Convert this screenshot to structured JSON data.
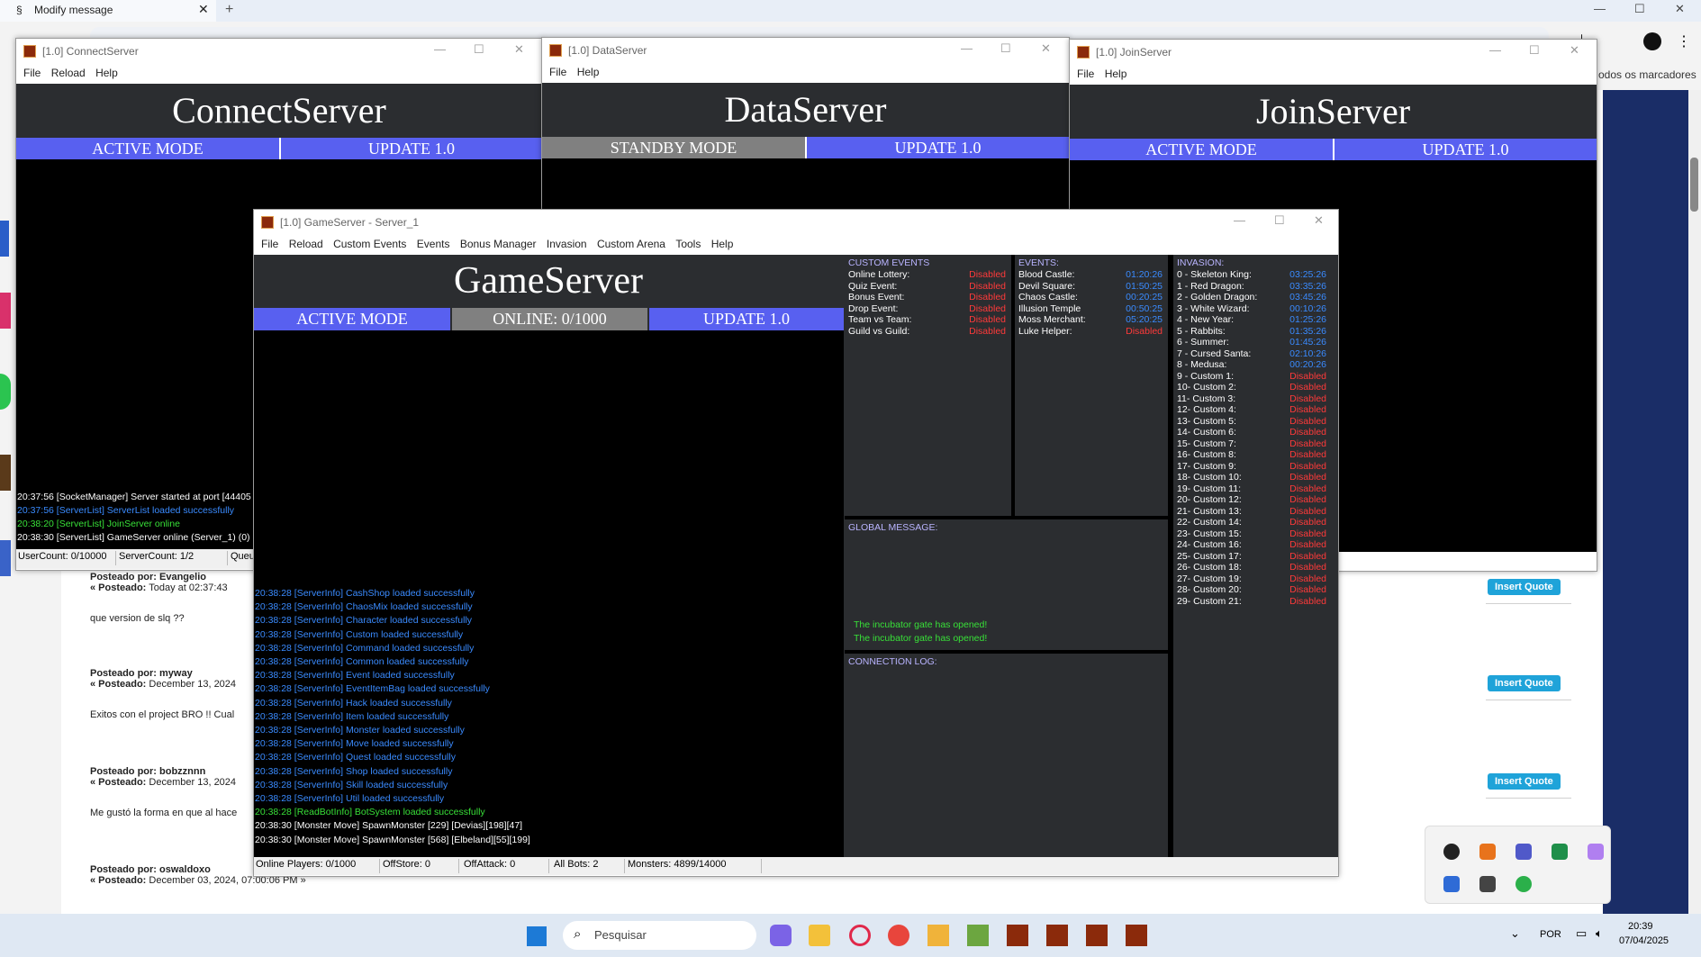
{
  "browser": {
    "tab_title": "Modify message",
    "new_tab": "+",
    "bookmarks_text": "odos os marcadores"
  },
  "forum": {
    "posts": [
      {
        "by_label": "Posteado por:",
        "author": "Evangelio",
        "date_label": "« Posteado:",
        "date": "Today at 02:37:43",
        "body": "que version de slq ??",
        "quote_button": "Insert Quote"
      },
      {
        "by_label": "Posteado por:",
        "author": "myway",
        "date_label": "« Posteado:",
        "date": "December 13, 2024",
        "body": "Exitos con el project BRO !! Cual",
        "quote_button": "Insert Quote"
      },
      {
        "by_label": "Posteado por:",
        "author": "bobzznnn",
        "date_label": "« Posteado:",
        "date": "December 13, 2024",
        "body": "Me gustó la forma en que al hace",
        "quote_button": "Insert Quote"
      },
      {
        "by_label": "Posteado por:",
        "author": "oswaldoxo",
        "date_label": "« Posteado:",
        "date": "December 03, 2024, 07:00:06 PM »",
        "body": "",
        "quote_button": ""
      }
    ]
  },
  "connect_server": {
    "window_title": "[1.0] ConnectServer",
    "menu": [
      "File",
      "Reload",
      "Help"
    ],
    "big_title": "ConnectServer",
    "mode": "ACTIVE MODE",
    "update": "UPDATE 1.0",
    "log": [
      {
        "text": "20:37:56 [SocketManager] Server started at port [44405",
        "color": "white"
      },
      {
        "text": "20:37:56 [ServerList] ServerList loaded successfully",
        "color": "blue"
      },
      {
        "text": "20:38:20 [ServerList] JoinServer online",
        "color": "green"
      },
      {
        "text": "20:38:30 [ServerList] GameServer online (Server_1) (0)",
        "color": "white"
      }
    ],
    "status": {
      "user_count": "UserCount: 0/10000",
      "server_count": "ServerCount: 1/2",
      "queue": "Queu"
    }
  },
  "data_server": {
    "window_title": "[1.0] DataServer",
    "menu": [
      "File",
      "Help"
    ],
    "big_title": "DataServer",
    "mode": "STANDBY MODE",
    "update": "UPDATE 1.0"
  },
  "join_server": {
    "window_title": "[1.0] JoinServer",
    "menu": [
      "File",
      "Help"
    ],
    "big_title": "JoinServer",
    "mode": "ACTIVE MODE",
    "update": "UPDATE 1.0"
  },
  "game_server": {
    "window_title": "[1.0] GameServer - Server_1",
    "menu": [
      "File",
      "Reload",
      "Custom Events",
      "Events",
      "Bonus Manager",
      "Invasion",
      "Custom Arena",
      "Tools",
      "Help"
    ],
    "big_title": "GameServer",
    "mode": "ACTIVE MODE",
    "online": "ONLINE: 0/1000",
    "update": "UPDATE 1.0",
    "log": [
      {
        "text": "20:38:28 [ServerInfo] CashShop loaded successfully",
        "color": "blue"
      },
      {
        "text": "20:38:28 [ServerInfo] ChaosMix loaded successfully",
        "color": "blue"
      },
      {
        "text": "20:38:28 [ServerInfo] Character loaded successfully",
        "color": "blue"
      },
      {
        "text": "20:38:28 [ServerInfo] Custom loaded successfully",
        "color": "blue"
      },
      {
        "text": "20:38:28 [ServerInfo] Command loaded successfully",
        "color": "blue"
      },
      {
        "text": "20:38:28 [ServerInfo] Common loaded successfully",
        "color": "blue"
      },
      {
        "text": "20:38:28 [ServerInfo] Event loaded successfully",
        "color": "blue"
      },
      {
        "text": "20:38:28 [ServerInfo] EventItemBag loaded successfully",
        "color": "blue"
      },
      {
        "text": "20:38:28 [ServerInfo] Hack loaded successfully",
        "color": "blue"
      },
      {
        "text": "20:38:28 [ServerInfo] Item loaded successfully",
        "color": "blue"
      },
      {
        "text": "20:38:28 [ServerInfo] Monster loaded successfully",
        "color": "blue"
      },
      {
        "text": "20:38:28 [ServerInfo] Move loaded successfully",
        "color": "blue"
      },
      {
        "text": "20:38:28 [ServerInfo] Quest loaded successfully",
        "color": "blue"
      },
      {
        "text": "20:38:28 [ServerInfo] Shop loaded successfully",
        "color": "blue"
      },
      {
        "text": "20:38:28 [ServerInfo] Skill loaded successfully",
        "color": "blue"
      },
      {
        "text": "20:38:28 [ServerInfo] Util loaded successfully",
        "color": "blue"
      },
      {
        "text": "20:38:28 [ReadBotInfo] BotSystem loaded successfully",
        "color": "green"
      },
      {
        "text": "20:38:30 [Monster Move] SpawnMonster [229] [Devias][198][47]",
        "color": "white"
      },
      {
        "text": "20:38:30 [Monster Move] SpawnMonster [568] [Elbeland][55][199]",
        "color": "white"
      }
    ],
    "custom_events": {
      "header": "CUSTOM EVENTS",
      "items": [
        {
          "name": "Online Lottery:",
          "value": "Disabled"
        },
        {
          "name": "Quiz Event:",
          "value": "Disabled"
        },
        {
          "name": "Bonus Event:",
          "value": "Disabled"
        },
        {
          "name": "Drop Event:",
          "value": "Disabled"
        },
        {
          "name": "Team vs Team:",
          "value": "Disabled"
        },
        {
          "name": "Guild vs Guild:",
          "value": "Disabled"
        }
      ]
    },
    "events": {
      "header": "EVENTS:",
      "items": [
        {
          "name": "Blood Castle:",
          "value": "01:20:26"
        },
        {
          "name": "Devil Square:",
          "value": "01:50:25"
        },
        {
          "name": "Chaos Castle:",
          "value": "00:20:25"
        },
        {
          "name": "Illusion Temple",
          "value": "00:50:25"
        },
        {
          "name": "Moss Merchant:",
          "value": "05:20:25"
        },
        {
          "name": "Luke Helper:",
          "value": "Disabled"
        }
      ]
    },
    "global_message": {
      "header": "GLOBAL MESSAGE:",
      "lines": [
        "The incubator gate has opened!",
        "The incubator gate has opened!"
      ]
    },
    "connection_log": {
      "header": "CONNECTION LOG:"
    },
    "invasion": {
      "header": "INVASION:",
      "items": [
        {
          "name": "0 - Skeleton King:",
          "value": "03:25:26"
        },
        {
          "name": "1 - Red Dragon:",
          "value": "03:35:26"
        },
        {
          "name": "2 - Golden Dragon:",
          "value": "03:45:26"
        },
        {
          "name": "3 - White Wizard:",
          "value": "00:10:26"
        },
        {
          "name": "4 - New Year:",
          "value": "01:25:26"
        },
        {
          "name": "5 - Rabbits:",
          "value": "01:35:26"
        },
        {
          "name": "6 - Summer:",
          "value": "01:45:26"
        },
        {
          "name": "7 - Cursed Santa:",
          "value": "02:10:26"
        },
        {
          "name": "8 - Medusa:",
          "value": "00:20:26"
        },
        {
          "name": "9 - Custom 1:",
          "value": "Disabled"
        },
        {
          "name": "10- Custom 2:",
          "value": "Disabled"
        },
        {
          "name": "11- Custom 3:",
          "value": "Disabled"
        },
        {
          "name": "12- Custom 4:",
          "value": "Disabled"
        },
        {
          "name": "13- Custom 5:",
          "value": "Disabled"
        },
        {
          "name": "14- Custom 6:",
          "value": "Disabled"
        },
        {
          "name": "15- Custom 7:",
          "value": "Disabled"
        },
        {
          "name": "16- Custom 8:",
          "value": "Disabled"
        },
        {
          "name": "17- Custom 9:",
          "value": "Disabled"
        },
        {
          "name": "18- Custom 10:",
          "value": "Disabled"
        },
        {
          "name": "19- Custom 11:",
          "value": "Disabled"
        },
        {
          "name": "20- Custom 12:",
          "value": "Disabled"
        },
        {
          "name": "21- Custom 13:",
          "value": "Disabled"
        },
        {
          "name": "22- Custom 14:",
          "value": "Disabled"
        },
        {
          "name": "23- Custom 15:",
          "value": "Disabled"
        },
        {
          "name": "24- Custom 16:",
          "value": "Disabled"
        },
        {
          "name": "25- Custom 17:",
          "value": "Disabled"
        },
        {
          "name": "26- Custom 18:",
          "value": "Disabled"
        },
        {
          "name": "27- Custom 19:",
          "value": "Disabled"
        },
        {
          "name": "28- Custom 20:",
          "value": "Disabled"
        },
        {
          "name": "29- Custom 21:",
          "value": "Disabled"
        }
      ]
    },
    "status": {
      "online_players": "Online Players: 0/1000",
      "offstore": "OffStore: 0",
      "offattack": "OffAttack: 0",
      "all_bots": "All Bots: 2",
      "monsters": "Monsters: 4899/14000"
    }
  },
  "taskbar": {
    "search_placeholder": "Pesquisar",
    "language": "POR",
    "time": "20:39",
    "date": "07/04/2025"
  },
  "colors": {
    "accent_blue": "#5860f0",
    "log_blue": "#3a8bff",
    "log_green": "#38e038",
    "disabled_red": "#ff3a3a"
  }
}
